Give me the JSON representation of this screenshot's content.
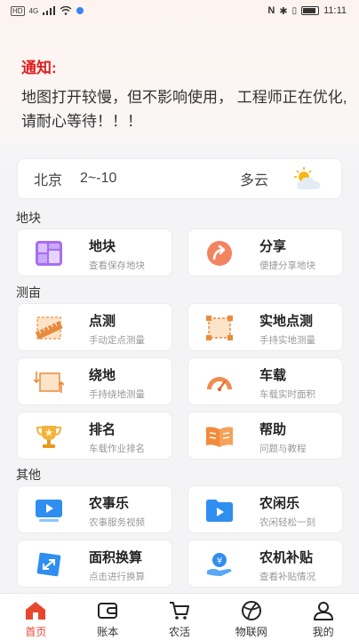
{
  "status_bar": {
    "left_badge": "HD",
    "left_signal": "4G",
    "time": "11:11",
    "nfc": "N"
  },
  "notice": {
    "title": "通知:",
    "text": "地图打开较慢，但不影响使用， 工程师正在优化,请耐心等待！！！"
  },
  "weather": {
    "city": "北京",
    "temp": "2~-10",
    "desc": "多云",
    "icon": "partly-cloudy-icon"
  },
  "sections": [
    {
      "label": "地块"
    },
    {
      "label": "测亩"
    },
    {
      "label": "其他"
    }
  ],
  "tiles": [
    {
      "title": "地块",
      "sub": "查看保存地块",
      "icon": "plot-grid-icon"
    },
    {
      "title": "分享",
      "sub": "便捷分享地块",
      "icon": "share-arrow-icon"
    },
    {
      "title": "点测",
      "sub": "手动定点测量",
      "icon": "ruler-icon"
    },
    {
      "title": "实地点测",
      "sub": "手持实地测量",
      "icon": "field-frame-icon"
    },
    {
      "title": "绕地",
      "sub": "手持绕地测量",
      "icon": "walk-around-icon"
    },
    {
      "title": "车载",
      "sub": "车载实时面积",
      "icon": "speedometer-icon"
    },
    {
      "title": "排名",
      "sub": "车载作业排名",
      "icon": "trophy-icon"
    },
    {
      "title": "帮助",
      "sub": "问题与教程",
      "icon": "book-icon"
    },
    {
      "title": "农事乐",
      "sub": "农事服务视频",
      "icon": "tv-play-icon"
    },
    {
      "title": "农闲乐",
      "sub": "农闲轻松一刻",
      "icon": "folder-play-icon"
    },
    {
      "title": "面积换算",
      "sub": "点击进行换算",
      "icon": "area-convert-icon"
    },
    {
      "title": "农机补贴",
      "sub": "查看补贴情况",
      "icon": "subsidy-icon"
    }
  ],
  "tabbar": [
    {
      "label": "首页",
      "icon": "home-icon",
      "active": true
    },
    {
      "label": "账本",
      "icon": "wallet-icon"
    },
    {
      "label": "农活",
      "icon": "cart-icon"
    },
    {
      "label": "物联网",
      "icon": "iot-globe-icon"
    },
    {
      "label": "我的",
      "icon": "user-icon"
    }
  ],
  "colors": {
    "accent": "#e8472f",
    "notice_title": "#e02020"
  }
}
